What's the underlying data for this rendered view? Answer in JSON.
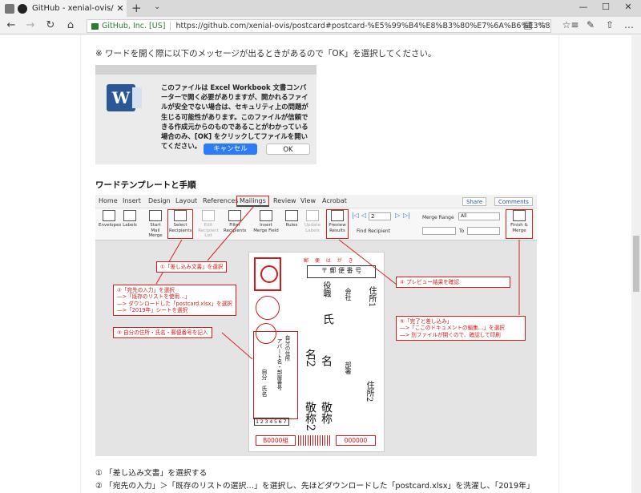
{
  "browser": {
    "tab_title": "GitHub - xenial-ovis/po",
    "tab_close": "✕",
    "new_tab": "+",
    "tab_dropdown": "⌄",
    "win_min": "—",
    "win_max": "☐",
    "win_close": "✕",
    "back": "←",
    "forward": "→",
    "refresh": "↻",
    "home": "⌂",
    "cert_name": "GitHub, Inc. [US]",
    "url": "https://github.com/xenial-ovis/postcard#postcard-%E5%99%B4%E8%B3%80%E7%6A%B6%E3%81%AE%E5%AE%9B%",
    "reading_view": "▤",
    "favorite": "☆",
    "favorites_list": "☆≡",
    "notes": "✎",
    "share": "⇧",
    "more": "…"
  },
  "page": {
    "note": "※ ワードを開く際に以下のメッセージが出るときがあるので「OK」を選択してください。",
    "dialog": {
      "icon_letter": "W",
      "message": "このファイルは Excel Workbook 文書コンバーターで開く必要がありますが、開かれるファイルが安全でない場合は、セキュリティ上の問題が生じる可能性があります。このファイルが信頼できる作成元からのものであることがわかっている場合のみ、[OK] をクリックしてファイルを開いてください。",
      "cancel": "キャンセル",
      "ok": "OK"
    },
    "heading": "ワードテンプレートと手順",
    "word": {
      "menu": [
        "Home",
        "Insert",
        "Design",
        "Layout",
        "References",
        "Mailings",
        "Review",
        "View",
        "Acrobat"
      ],
      "share": "Share",
      "comments": "Comments",
      "ribbon": {
        "envelopes": "Envelopes",
        "labels": "Labels",
        "start_mail_merge": "Start Mail Merge",
        "select_recipients": "Select Recipients",
        "edit_recipient_list": "Edit Recipient List",
        "filter_recipients": "Filter Recipients",
        "insert_merge_field": "Insert Merge Field",
        "rules": "Rules",
        "update_labels": "Update Labels",
        "preview_results": "Preview Results",
        "find_recipient": "Find Recipient",
        "record_number": "2",
        "merge_range": "Merge Range",
        "range_value": "All",
        "to": "To",
        "finish_merge": "Finish & Merge"
      },
      "postcard": {
        "header": "郵 便 は が き",
        "zip_digits": [
          "〒",
          "郵",
          "便",
          "番",
          "号"
        ],
        "address1": "住所1",
        "address2": "住所2",
        "company": "会社",
        "department": "部署",
        "title": "役職",
        "name1": "氏",
        "name2": "名",
        "name_second": "名2",
        "honorific1": "敬称",
        "honorific2": "敬称2",
        "sender_address": "自分の住所",
        "sender_building": "アパート名・部屋番号",
        "sender_name": "自分　氏名",
        "sender_zip": "1234567",
        "field_b": "B0000組",
        "field_zip": "000000"
      },
      "callouts": {
        "c1": "①「差し込み文書」を選択",
        "c2": [
          "②「宛先の入力」を選択",
          "―>「既存のリストを使用…」",
          "―> ダウンロードした「postcard.xlsx」を選択",
          "―>「2019年」シートを選択"
        ],
        "c3": "③ 自分の住所・氏名・郵便番号を記入",
        "c4": "④ プレビュー結果を確認",
        "c5": [
          "⑤「完了と差し込み」",
          "―>「ここのドキュメントの編集…」を選択",
          "―> 別ファイルが開くので、確認して印刷"
        ]
      }
    },
    "steps": [
      "① 「差し込み文書」を選択する",
      "② 「宛先の入力」＞「既存のリストの選択…」を選択し、先ほどダウンロードした「postcard.xlsx」を洗濯し、「2019年」"
    ]
  }
}
